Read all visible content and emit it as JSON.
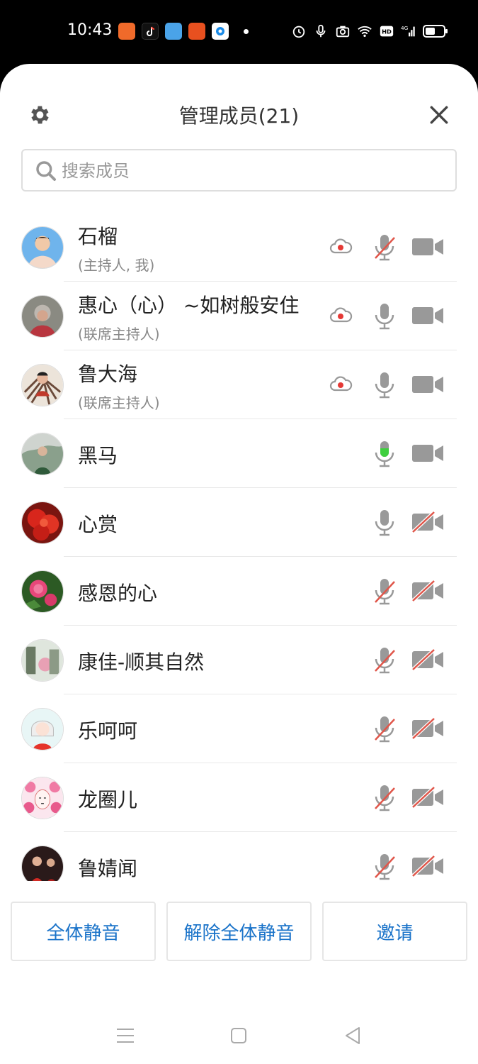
{
  "status_bar": {
    "time": "10:43"
  },
  "header": {
    "title": "管理成员(21)"
  },
  "search": {
    "placeholder": "搜索成员"
  },
  "members": [
    {
      "name": "石榴",
      "role": "(主持人, 我)",
      "recording": true,
      "mic": "muted",
      "camera": "on"
    },
    {
      "name": "惠心（心） ~如树般安住",
      "role": "(联席主持人)",
      "recording": true,
      "mic": "on",
      "camera": "on"
    },
    {
      "name": "鲁大海",
      "role": "(联席主持人)",
      "recording": true,
      "mic": "on",
      "camera": "on"
    },
    {
      "name": "黑马",
      "role": "",
      "recording": false,
      "mic": "speaking",
      "camera": "on"
    },
    {
      "name": "心赏",
      "role": "",
      "recording": false,
      "mic": "on",
      "camera": "off"
    },
    {
      "name": "感恩的心",
      "role": "",
      "recording": false,
      "mic": "muted",
      "camera": "off"
    },
    {
      "name": "康佳-顺其自然",
      "role": "",
      "recording": false,
      "mic": "muted",
      "camera": "off"
    },
    {
      "name": "乐呵呵",
      "role": "",
      "recording": false,
      "mic": "muted",
      "camera": "off"
    },
    {
      "name": "龙圈儿",
      "role": "",
      "recording": false,
      "mic": "muted",
      "camera": "off"
    },
    {
      "name": "鲁婧闻",
      "role": "",
      "recording": false,
      "mic": "muted",
      "camera": "off"
    }
  ],
  "actions": {
    "mute_all": "全体静音",
    "unmute_all": "解除全体静音",
    "invite": "邀请"
  },
  "colors": {
    "accent": "#1a73c9",
    "muted_slash": "#e0564a",
    "speaking": "#3ecf3e",
    "icon_gray": "#888888",
    "recording_dot": "#e53935"
  },
  "icons": {
    "settings": "gear-icon",
    "close": "close-icon",
    "search": "search-icon",
    "recording": "cloud-record-icon",
    "mic": "microphone-icon",
    "camera": "video-camera-icon"
  }
}
